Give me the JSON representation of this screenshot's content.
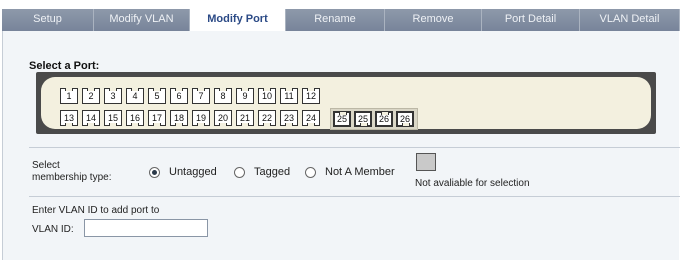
{
  "tabs": [
    {
      "label": "Setup",
      "active": false
    },
    {
      "label": "Modify VLAN",
      "active": false
    },
    {
      "label": "Modify Port",
      "active": true
    },
    {
      "label": "Rename",
      "active": false
    },
    {
      "label": "Remove",
      "active": false
    },
    {
      "label": "Port Detail",
      "active": false
    },
    {
      "label": "VLAN Detail",
      "active": false
    }
  ],
  "port_section": {
    "title": "Select a Port:",
    "top_row": [
      "1",
      "2",
      "3",
      "4",
      "5",
      "6",
      "7",
      "8",
      "9",
      "10",
      "11",
      "12"
    ],
    "bottom_row": [
      "13",
      "14",
      "15",
      "16",
      "17",
      "18",
      "19",
      "20",
      "21",
      "22",
      "23",
      "24"
    ],
    "sfp_ports": [
      "25",
      "25",
      "26",
      "26"
    ]
  },
  "membership": {
    "label_line1": "Select",
    "label_line2": "membership type:",
    "options": [
      {
        "label": "Untagged",
        "checked": true
      },
      {
        "label": "Tagged",
        "checked": false
      },
      {
        "label": "Not A Member",
        "checked": false
      }
    ],
    "na_label": "Not avaliable for selection"
  },
  "vlan": {
    "prompt": "Enter VLAN ID to add port to",
    "label": "VLAN ID:",
    "value": "",
    "placeholder": ""
  },
  "colors": {
    "tab_bar": "#7f8a9b",
    "active_tab_text": "#2b4a86",
    "faceplate": "#4a4a4a",
    "faceplate_inner": "#f3f0df",
    "panel": "#f2f5f8"
  }
}
